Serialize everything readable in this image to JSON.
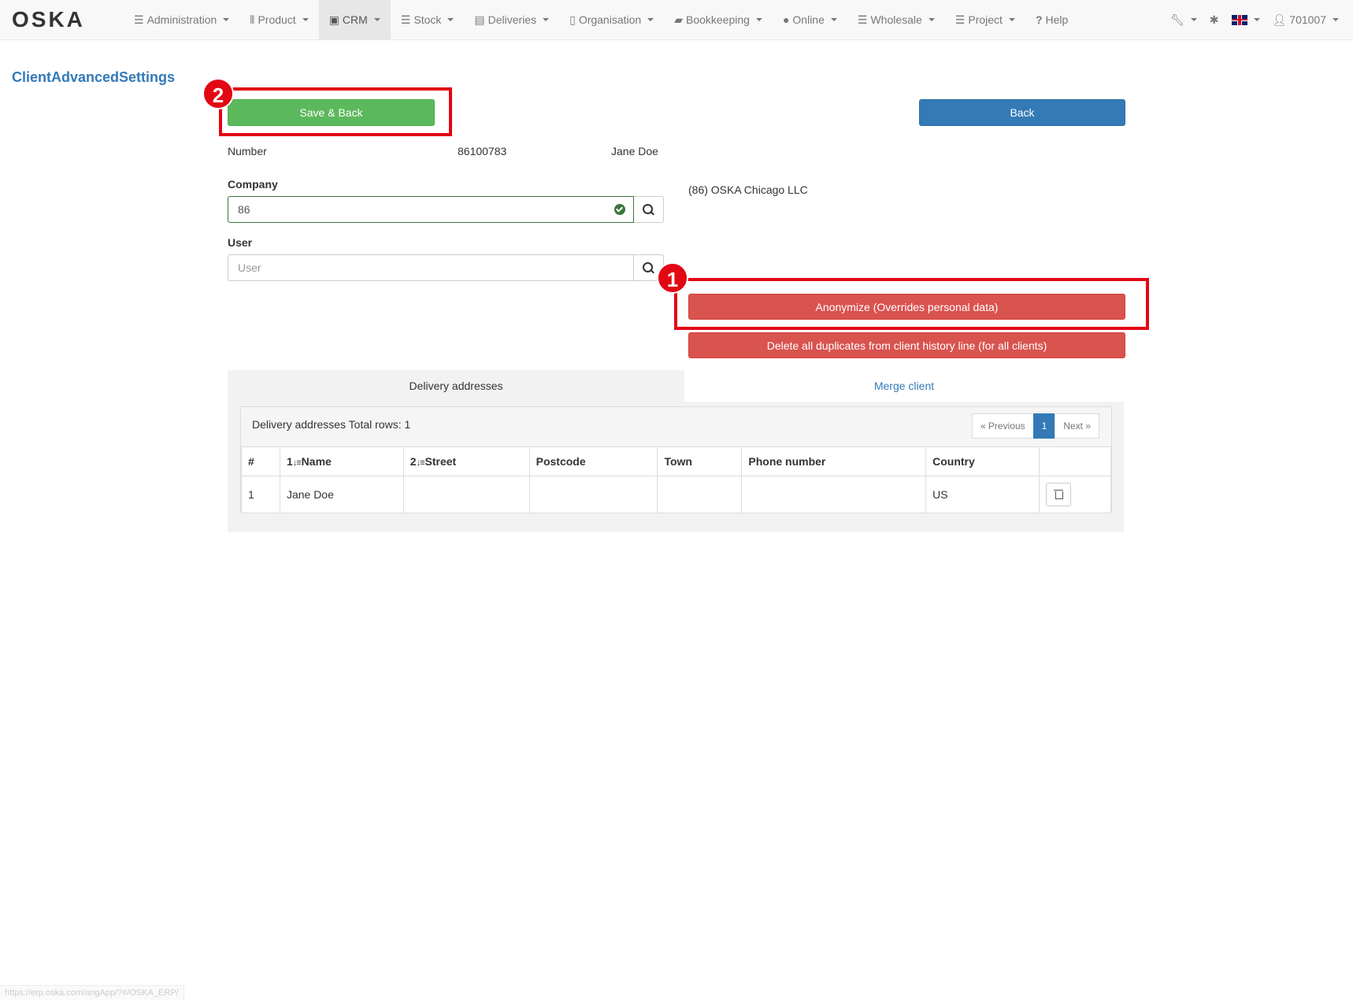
{
  "navbar": {
    "brand": "OSKA",
    "items": [
      {
        "label": "Administration",
        "icon": "list-icon"
      },
      {
        "label": "Product",
        "icon": "barcode-icon"
      },
      {
        "label": "CRM",
        "icon": "contact-card-icon"
      },
      {
        "label": "Stock",
        "icon": "list-icon"
      },
      {
        "label": "Deliveries",
        "icon": "box-icon"
      },
      {
        "label": "Organisation",
        "icon": "building-icon"
      },
      {
        "label": "Bookkeeping",
        "icon": "book-icon"
      },
      {
        "label": "Online",
        "icon": "globe-icon"
      },
      {
        "label": "Wholesale",
        "icon": "list-icon"
      },
      {
        "label": "Project",
        "icon": "list-icon"
      },
      {
        "label": "Help",
        "icon": "question-icon"
      }
    ],
    "user": "701007"
  },
  "page": {
    "title": "ClientAdvancedSettings",
    "save_back": "Save & Back",
    "back": "Back",
    "number_label": "Number",
    "number_value": "86100783",
    "client_name": "Jane Doe",
    "company_label": "Company",
    "company_value": "86",
    "company_display": "(86) OSKA Chicago LLC",
    "user_label": "User",
    "user_placeholder": "User",
    "anonymize": "Anonymize (Overrides personal data)",
    "delete_duplicates": "Delete all duplicates from client history line (for all clients)"
  },
  "markers": {
    "one": "1",
    "two": "2"
  },
  "tabs": {
    "delivery": "Delivery addresses",
    "merge": "Merge client"
  },
  "table": {
    "caption": "Delivery addresses Total rows: 1",
    "pager": {
      "prev": "« Previous",
      "page": "1",
      "next": "Next »"
    },
    "headers": {
      "num": "#",
      "name_sort": "1",
      "name": "Name",
      "street_sort": "2",
      "street": "Street",
      "postcode": "Postcode",
      "town": "Town",
      "phone": "Phone number",
      "country": "Country"
    },
    "rows": [
      {
        "num": "1",
        "name": "Jane Doe",
        "street": "",
        "postcode": "",
        "town": "",
        "phone": "",
        "country": "US"
      }
    ]
  },
  "status_url": "https://erp.oska.com/angApp/?#/OSKA_ERP/",
  "colors": {
    "success": "#5cb85c",
    "primary": "#337ab7",
    "danger": "#d9534f",
    "highlight": "#e30613"
  }
}
